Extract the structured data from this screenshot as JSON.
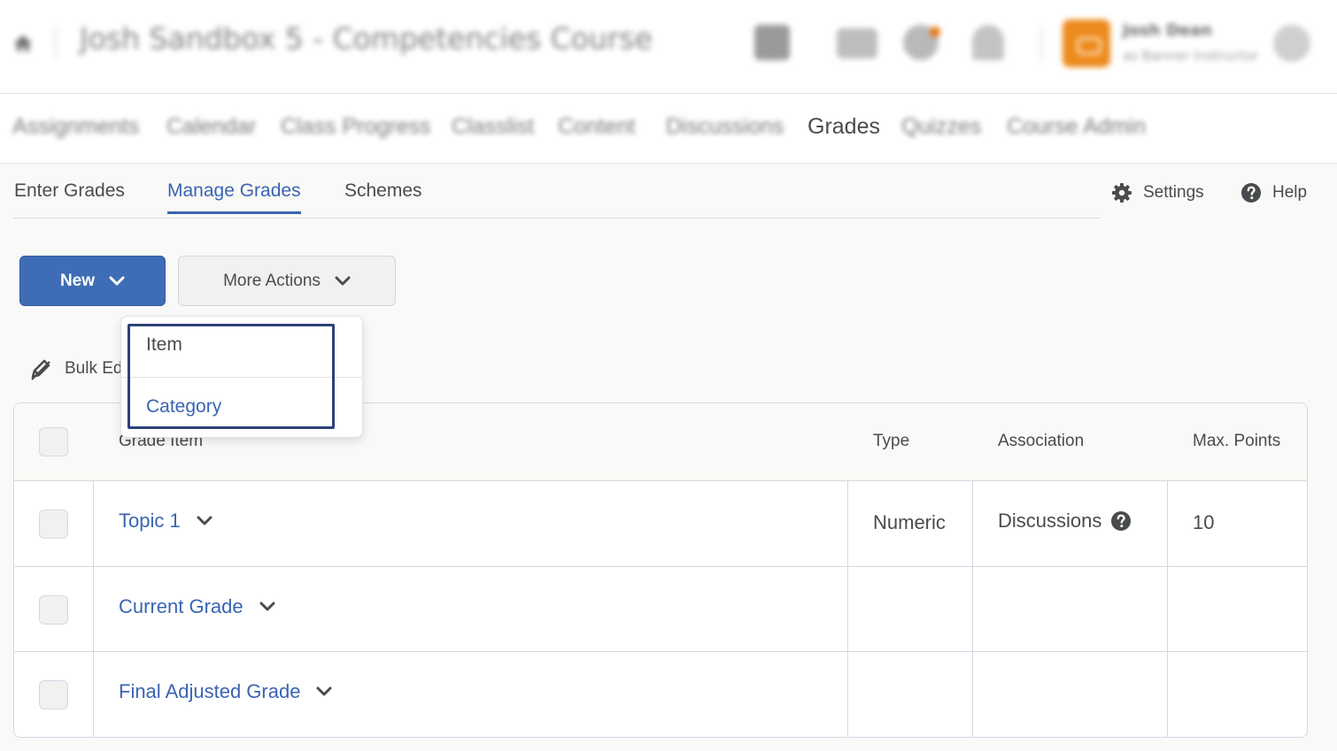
{
  "header": {
    "course_title": "Josh Sandbox 5 - Competencies Course",
    "user_name": "Josh Dean",
    "user_role": "as Banner Instructor",
    "icons": [
      "home-icon",
      "grid-icon",
      "mail-icon",
      "chat-icon",
      "bell-icon"
    ]
  },
  "course_nav": {
    "items": [
      "Assignments",
      "Calendar",
      "Class Progress",
      "Classlist",
      "Content",
      "Discussions",
      "Grades",
      "Quizzes",
      "Course Admin"
    ],
    "active": "Grades"
  },
  "tabs": {
    "enter": "Enter Grades",
    "manage": "Manage Grades",
    "schemes": "Schemes",
    "active": "Manage Grades"
  },
  "utilities": {
    "settings": "Settings",
    "help": "Help"
  },
  "toolbar": {
    "new_label": "New",
    "more_actions_label": "More Actions",
    "bulk_edit_label": "Bulk Ed"
  },
  "dropdown": {
    "items": [
      "Item",
      "Category"
    ]
  },
  "table": {
    "headers": {
      "grade_item": "Grade Item",
      "type": "Type",
      "association": "Association",
      "max_points": "Max. Points"
    },
    "rows": [
      {
        "name": "Topic 1",
        "type": "Numeric",
        "association": "Discussions",
        "max_points": "10"
      },
      {
        "name": "Current Grade",
        "type": "",
        "association": "",
        "max_points": ""
      },
      {
        "name": "Final Adjusted Grade",
        "type": "",
        "association": "",
        "max_points": ""
      }
    ]
  },
  "colors": {
    "primary": "#3e6db5",
    "link": "#3a64b3",
    "text": "#494c4e",
    "border": "#d3d9e3",
    "highlight": "#2d4178",
    "accent": "#ec8a1d"
  }
}
